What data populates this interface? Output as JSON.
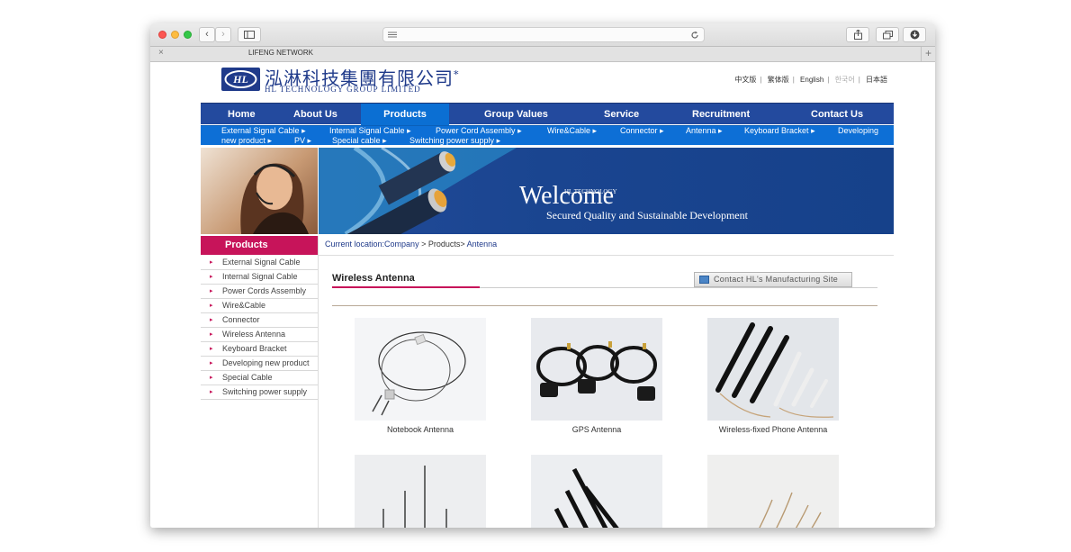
{
  "browser": {
    "tab_title": "LIFENG NETWORK",
    "tab_close": "×",
    "tab_add": "+"
  },
  "site": {
    "logo_cn": "泓淋科技集團有限公司",
    "logo_mark": "*",
    "logo_en": "HL TECHNOLOGY GROUP LIMITED",
    "languages": [
      "中文版",
      "繁体版",
      "English",
      "한국어",
      "日本語"
    ]
  },
  "nav": {
    "items": [
      "Home",
      "About Us",
      "Products",
      "Group Values",
      "Service",
      "Recruitment",
      "Contact Us"
    ],
    "active": "Products"
  },
  "subnav": {
    "row1": [
      "External Signal Cable",
      "Internal Signal Cable",
      "Power Cord Assembly",
      "Wire&Cable",
      "Connector",
      "Antenna",
      "Keyboard Bracket",
      "Developing"
    ],
    "row2": [
      "new product",
      "PV",
      "Special cable",
      "Switching power supply"
    ],
    "arrow": "▸"
  },
  "banner": {
    "welcome": "Welcome",
    "welcome_small": "HL TECHNOLOGY",
    "tagline": "Secured Quality and Sustainable Development"
  },
  "sidebar": {
    "title": "Products",
    "bullet": "▸",
    "items": [
      "External Signal Cable",
      "Internal Signal Cable",
      "Power Cords Assembly",
      "Wire&Cable",
      "Connector",
      "Wireless Antenna",
      "Keyboard Bracket",
      "Developing new product",
      "Special Cable",
      "Switching power supply"
    ]
  },
  "breadcrumb": {
    "label": "Current location:",
    "company": "Company",
    "sep1": " > ",
    "products": "Products",
    "sep2": "> ",
    "current": "Antenna"
  },
  "section": {
    "title": "Wireless Antenna",
    "contact_button": "Contact HL's Manufacturing Site"
  },
  "products": [
    {
      "name": "Notebook Antenna"
    },
    {
      "name": "GPS Antenna"
    },
    {
      "name": "Wireless-fixed Phone Antenna"
    }
  ],
  "colors": {
    "nav_bg": "#234a9e",
    "nav_active": "#0b6fd3",
    "accent_magenta": "#c7145a",
    "brand_blue": "#1f3a8a"
  }
}
